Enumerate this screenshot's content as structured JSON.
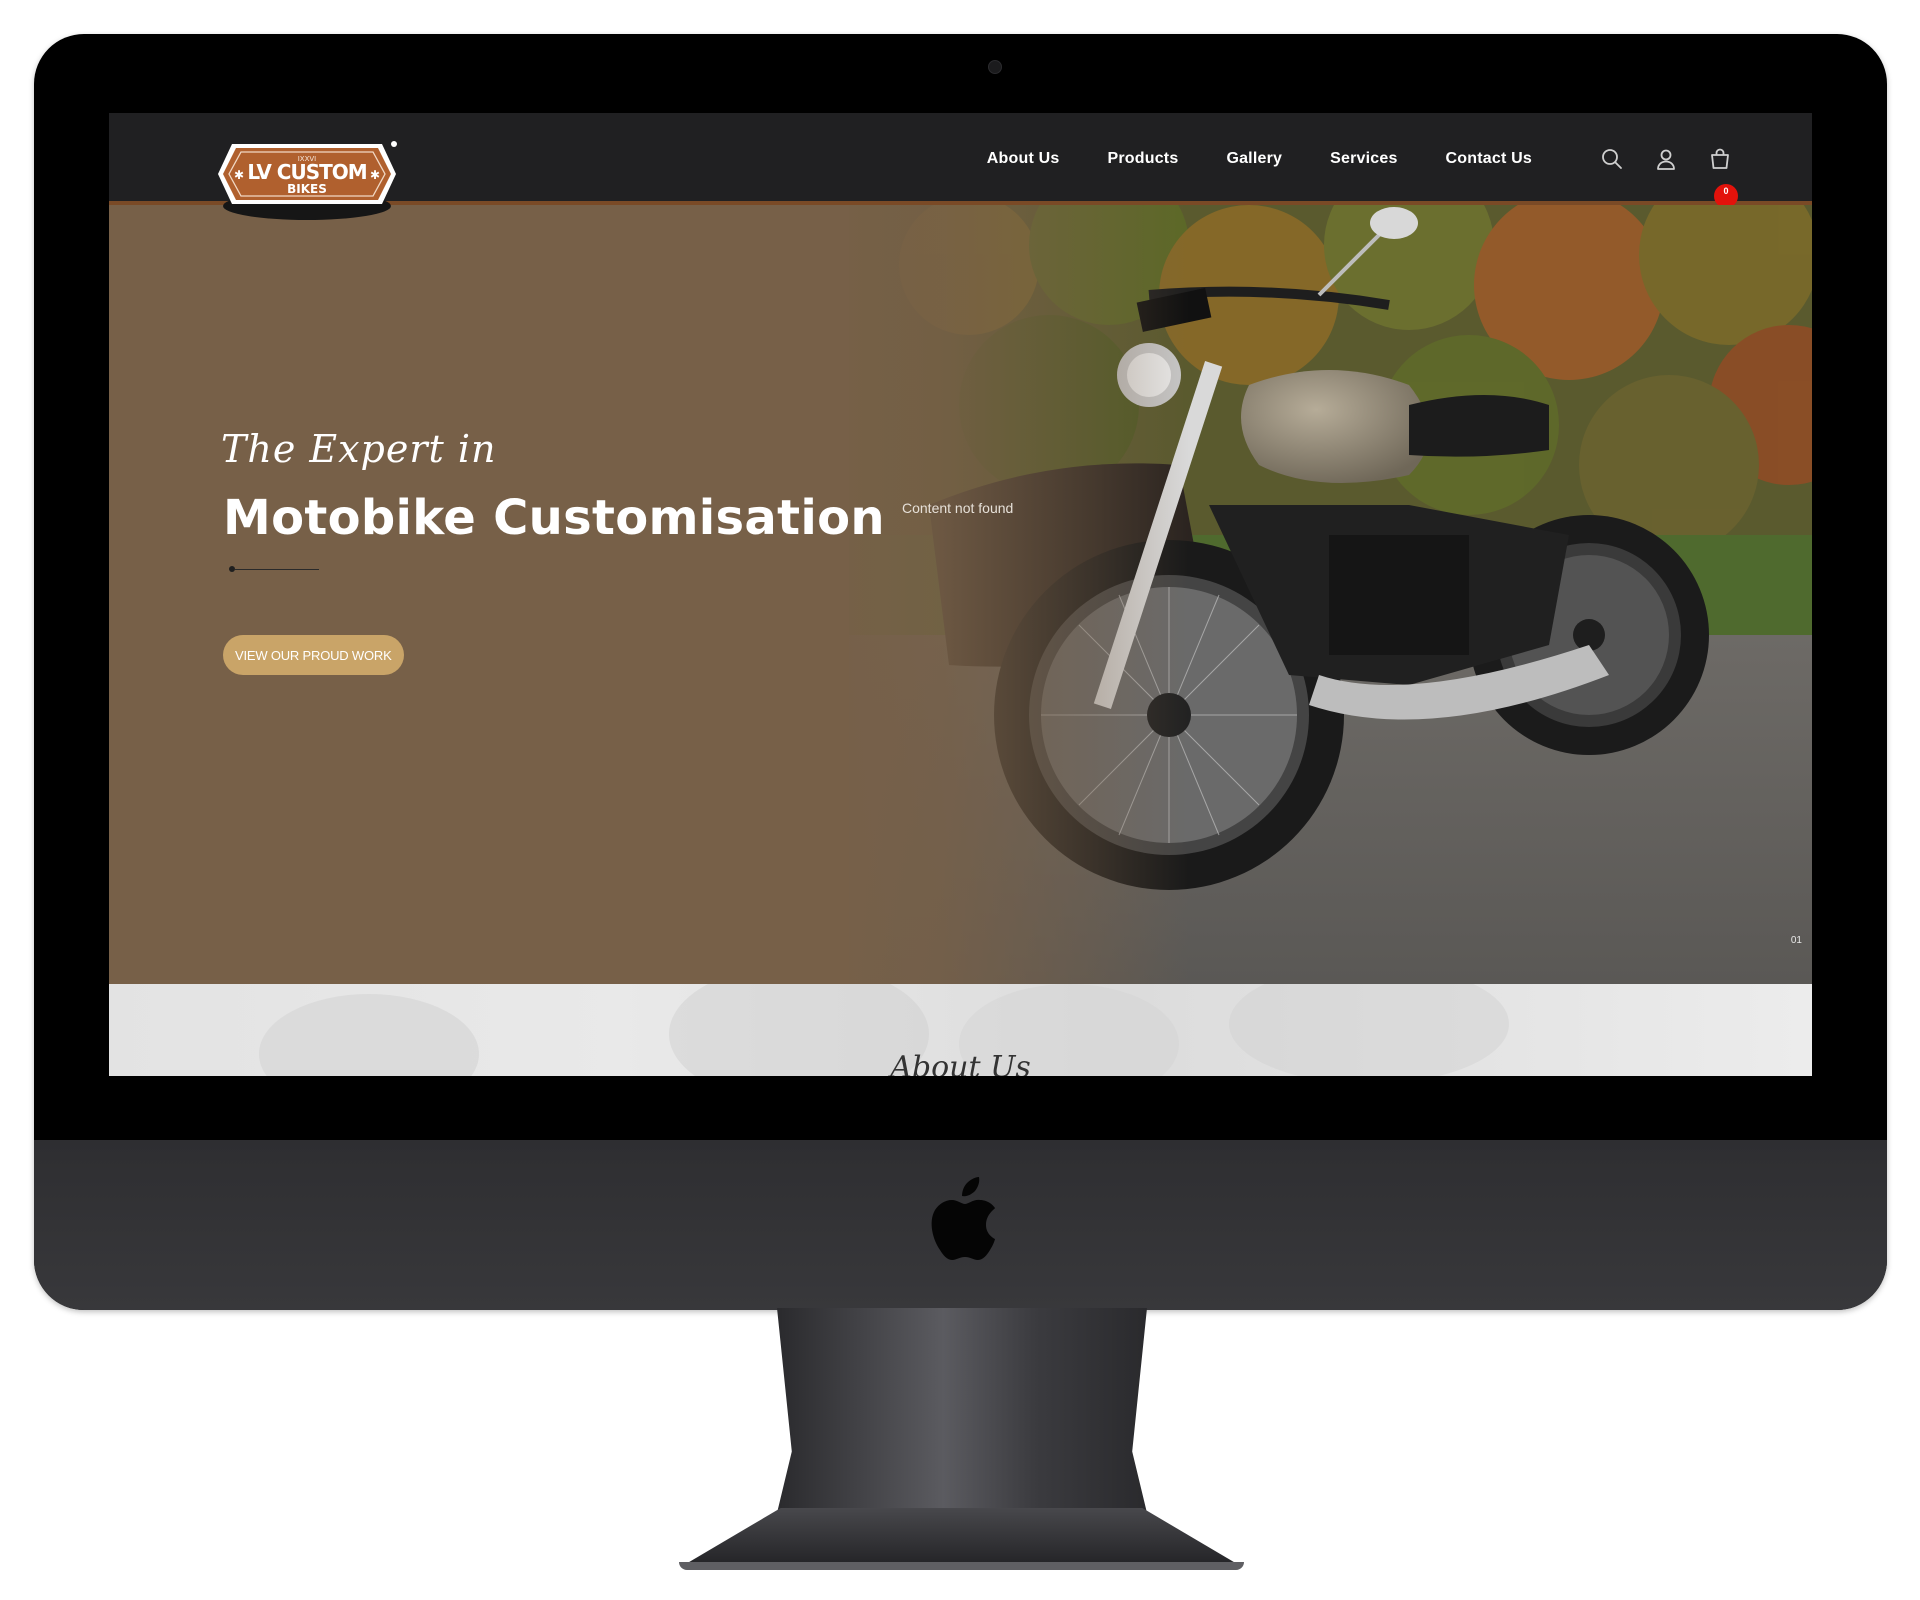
{
  "site": {
    "logo": {
      "top_text": "IXXVI",
      "main_text": "LV CUSTOM",
      "sub_text": "BIKES"
    },
    "nav": {
      "items": [
        "About Us",
        "Products",
        "Gallery",
        "Services",
        "Contact Us"
      ]
    },
    "header_icons": {
      "search": "search-icon",
      "user": "user-icon",
      "cart": "cart-icon",
      "cart_count": "0"
    },
    "hero": {
      "script_line": "The Expert in",
      "title": "Motobike Customisation",
      "cta_label": "VIEW OUR PROUD WORK",
      "note": "Content not found",
      "slide_number": "01"
    },
    "about": {
      "heading": "About Us"
    }
  },
  "colors": {
    "header_bg": "#202022",
    "hero_bg": "#776048",
    "accent": "#c9a468",
    "header_border": "#7a4a26",
    "badge": "#e3120b"
  }
}
